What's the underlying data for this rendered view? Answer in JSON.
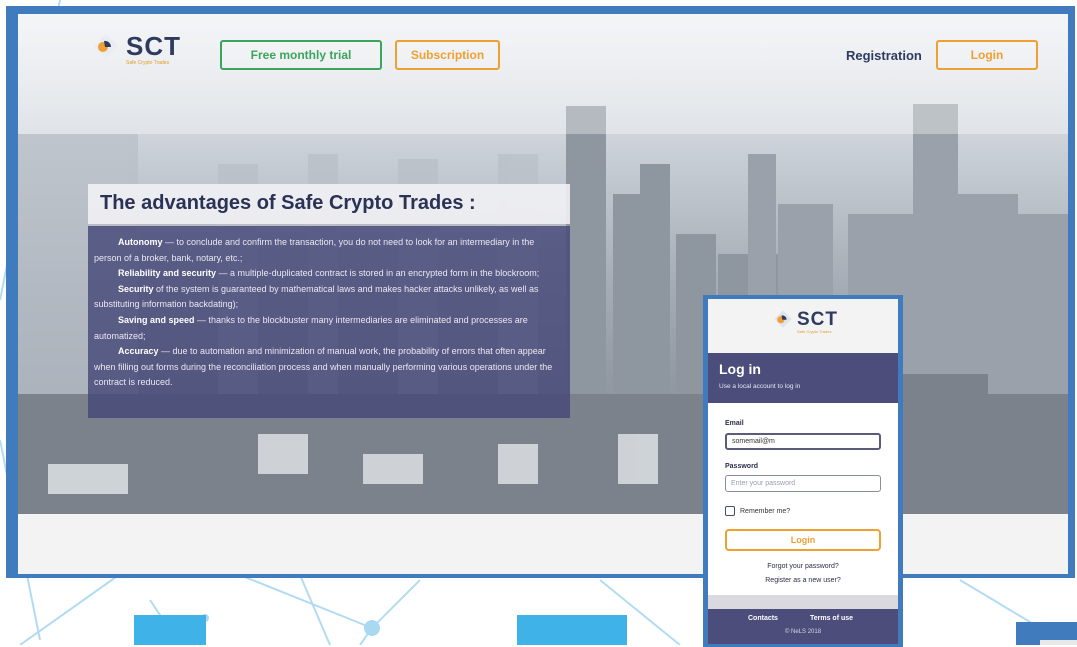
{
  "header": {
    "logo_text": "SCT",
    "logo_tagline": "Safe Crypto Trades",
    "free_trial_label": "Free monthly trial",
    "subscription_label": "Subscription",
    "registration_label": "Registration",
    "login_label": "Login"
  },
  "advantages": {
    "title": "The advantages of  Safe Crypto Trades :",
    "items": [
      {
        "term": "Autonomy",
        "text": " — to conclude and confirm the transaction, you do not need to look for an intermediary in the person of a broker, bank, notary, etc.;"
      },
      {
        "term": "Reliability and security",
        "text": " — a multiple-duplicated contract is stored in an encrypted form in the blockroom;"
      },
      {
        "term": "Security",
        "text": " of the system is guaranteed by mathematical laws and makes hacker attacks unlikely, as well as substituting information backdating);"
      },
      {
        "term": "Saving and speed",
        "text": " — thanks to the blockbuster many intermediaries are eliminated and processes are automatized;"
      },
      {
        "term": "Accuracy",
        "text": " — due to automation and minimization of manual work, the probability of errors that often appear when filling out forms during the reconciliation process and when manually performing various operations under the contract is reduced."
      }
    ]
  },
  "login_card": {
    "logo_text": "SCT",
    "logo_tagline": "Safe Crypto Trades",
    "title": "Log in",
    "subtitle": "Use a local account to log in",
    "email_label": "Email",
    "email_value": "somemail@m",
    "password_label": "Password",
    "password_placeholder": "Enter your password",
    "remember_label": "Remember me?",
    "login_button": "Login",
    "forgot_link": "Forgot your password?",
    "register_link": "Register as a new user?",
    "footer": {
      "contacts": "Contacts",
      "terms": "Terms of use",
      "copyright": "© NeLS 2018"
    }
  },
  "colors": {
    "frame_blue": "#3f7bbd",
    "accent_orange": "#f0a033",
    "trial_green": "#3ba55c",
    "panel_purple": "#4c4d7b",
    "light_blue_block": "#3fb2e8"
  },
  "icons": [
    "sct-logo-icon",
    "checkbox-icon"
  ]
}
